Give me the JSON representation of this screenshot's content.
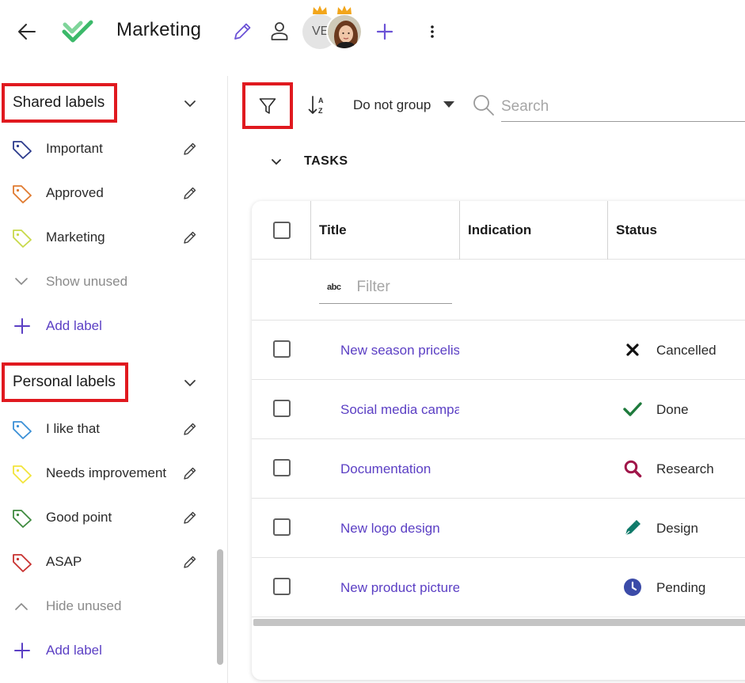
{
  "header": {
    "title": "Marketing",
    "avatar_initials": "VE"
  },
  "sidebar": {
    "shared": {
      "title": "Shared labels",
      "items": [
        {
          "label": "Important",
          "color": "#2b3a8c"
        },
        {
          "label": "Approved",
          "color": "#e07a2f"
        },
        {
          "label": "Marketing",
          "color": "#c8d94a"
        }
      ],
      "toggle_label": "Show unused",
      "add_label": "Add label"
    },
    "personal": {
      "title": "Personal labels",
      "items": [
        {
          "label": "I like that",
          "color": "#3a8fd6"
        },
        {
          "label": "Needs improvement",
          "color": "#f2e43a"
        },
        {
          "label": "Good point",
          "color": "#3f8a3f"
        },
        {
          "label": "ASAP",
          "color": "#c8312f"
        }
      ],
      "toggle_label": "Hide unused",
      "add_label": "Add label"
    }
  },
  "toolbar": {
    "group_value": "Do not group",
    "search_placeholder": "Search"
  },
  "tasks": {
    "section_title": "TASKS",
    "columns": [
      "Title",
      "Indication",
      "Status"
    ],
    "filter_placeholder": "Filter",
    "filter_type_icon": "abc",
    "rows": [
      {
        "title": "New season pricelist",
        "status": "Cancelled",
        "status_icon": "x-icon",
        "status_color": "#111111"
      },
      {
        "title": "Social media campaign",
        "status": "Done",
        "status_icon": "check-icon",
        "status_color": "#1e7a3c"
      },
      {
        "title": "Documentation",
        "status": "Research",
        "status_icon": "magnifier-icon",
        "status_color": "#a0174a"
      },
      {
        "title": "New logo design",
        "status": "Design",
        "status_icon": "pen-nib-icon",
        "status_color": "#0f7a6a"
      },
      {
        "title": "New product pictures",
        "status": "Pending",
        "status_icon": "clock-icon",
        "status_color": "#3b4ba8"
      }
    ]
  },
  "colors": {
    "accent": "#5b3fc4",
    "highlight_box": "#e0191f",
    "check_logo": "#3cb96a"
  }
}
